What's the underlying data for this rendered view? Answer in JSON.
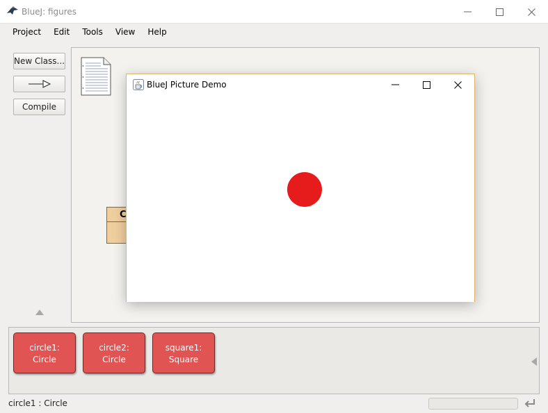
{
  "window": {
    "title": "BlueJ:  figures",
    "controls": {
      "minimize": "—",
      "maximize": "☐",
      "close": "✕"
    }
  },
  "menu": [
    {
      "label": "Project"
    },
    {
      "label": "Edit"
    },
    {
      "label": "Tools"
    },
    {
      "label": "View"
    },
    {
      "label": "Help"
    }
  ],
  "toolbar": {
    "new_class_label": "New Class...",
    "arrow_icon": "inheritance-arrow-icon",
    "compile_label": "Compile"
  },
  "diagram": {
    "readme_icon": "readme-document-icon",
    "class_name_partial": "C"
  },
  "picture_demo": {
    "title": "BlueJ Picture Demo",
    "icon": "java-cup-icon",
    "circle_color": "#e61b1b",
    "controls": {
      "minimize": "—",
      "maximize": "☐",
      "close": "✕"
    }
  },
  "object_bench": {
    "objects": [
      {
        "name": "circle1:",
        "type": "Circle"
      },
      {
        "name": "circle2:",
        "type": "Circle"
      },
      {
        "name": "square1:",
        "type": "Square"
      }
    ],
    "object_color": "#e05454"
  },
  "status": {
    "text": "circle1 : Circle"
  }
}
